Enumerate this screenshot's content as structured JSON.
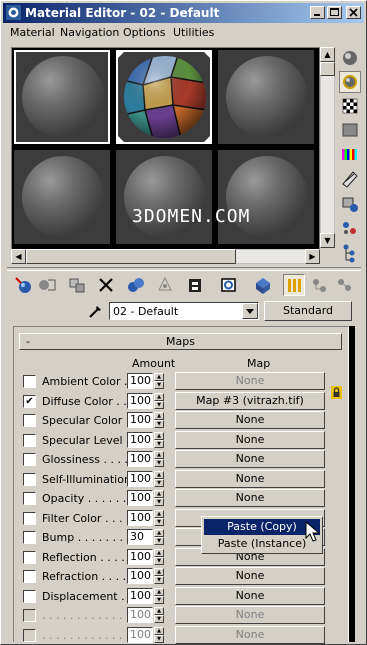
{
  "window": {
    "title": "Material Editor - 02 - Default"
  },
  "menu": [
    "Material",
    "Navigation",
    "Options",
    "Utilities"
  ],
  "watermark": "3DOMEN.COM",
  "material_name": "02 - Default",
  "material_type": "Standard",
  "rollout": {
    "collapse": "-",
    "title": "Maps"
  },
  "columns": {
    "amount": "Amount",
    "map": "Map"
  },
  "maps": [
    {
      "label": "Ambient Color . .",
      "checked": false,
      "amount": "100",
      "map": "None",
      "disabled": false,
      "dim": true
    },
    {
      "label": "Diffuse Color . . .",
      "checked": true,
      "amount": "100",
      "map": "Map #3 (vitrazh.tif)",
      "disabled": false,
      "dim": false
    },
    {
      "label": "Specular Color . .",
      "checked": false,
      "amount": "100",
      "map": "None",
      "disabled": false,
      "dim": false
    },
    {
      "label": "Specular Level . .",
      "checked": false,
      "amount": "100",
      "map": "None",
      "disabled": false,
      "dim": false
    },
    {
      "label": "Glossiness . . . . .",
      "checked": false,
      "amount": "100",
      "map": "None",
      "disabled": false,
      "dim": false
    },
    {
      "label": "Self-Illumination . .",
      "checked": false,
      "amount": "100",
      "map": "None",
      "disabled": false,
      "dim": false
    },
    {
      "label": "Opacity . . . . . . .",
      "checked": false,
      "amount": "100",
      "map": "None",
      "disabled": false,
      "dim": false
    },
    {
      "label": "Filter Color . . . . .",
      "checked": false,
      "amount": "100",
      "map": "",
      "disabled": false,
      "dim": false
    },
    {
      "label": "Bump . . . . . . . .",
      "checked": false,
      "amount": "30",
      "map": "",
      "disabled": false,
      "dim": false
    },
    {
      "label": "Reflection . . . . .",
      "checked": false,
      "amount": "100",
      "map": "None",
      "disabled": false,
      "dim": false
    },
    {
      "label": "Refraction . . . . .",
      "checked": false,
      "amount": "100",
      "map": "None",
      "disabled": false,
      "dim": false
    },
    {
      "label": "Displacement . . .",
      "checked": false,
      "amount": "100",
      "map": "None",
      "disabled": false,
      "dim": false
    },
    {
      "label": ". . . . . . . . . . . .",
      "checked": false,
      "amount": "100",
      "map": "None",
      "disabled": true,
      "dim": false
    },
    {
      "label": ". . . . . . . . . . . .",
      "checked": false,
      "amount": "100",
      "map": "None",
      "disabled": true,
      "dim": false
    }
  ],
  "context_menu": [
    "Paste (Copy)",
    "Paste (Instance)"
  ],
  "icons": {
    "side": [
      "sample-type-sphere-icon",
      "backlight-icon",
      "background-checker-icon",
      "sample-uv-tiling-icon",
      "video-color-check-icon",
      "make-preview-icon",
      "options-icon",
      "select-by-material-icon",
      "material-map-navigator-icon"
    ],
    "toolbar": [
      "get-material-icon",
      "put-to-scene-icon",
      "assign-to-selection-icon",
      "reset-map-icon",
      "make-unique-icon",
      "put-to-library-icon",
      "material-effects-channel-icon",
      "show-map-in-viewport-icon",
      "show-end-result-icon",
      "go-to-parent-icon",
      "go-forward-to-sibling-icon"
    ],
    "pick": "pick-material-from-object-icon"
  },
  "colors": {
    "title_start": "#0a246a",
    "title_end": "#a6caf0",
    "face": "#d4d0c8",
    "selection": "#0a246a"
  }
}
